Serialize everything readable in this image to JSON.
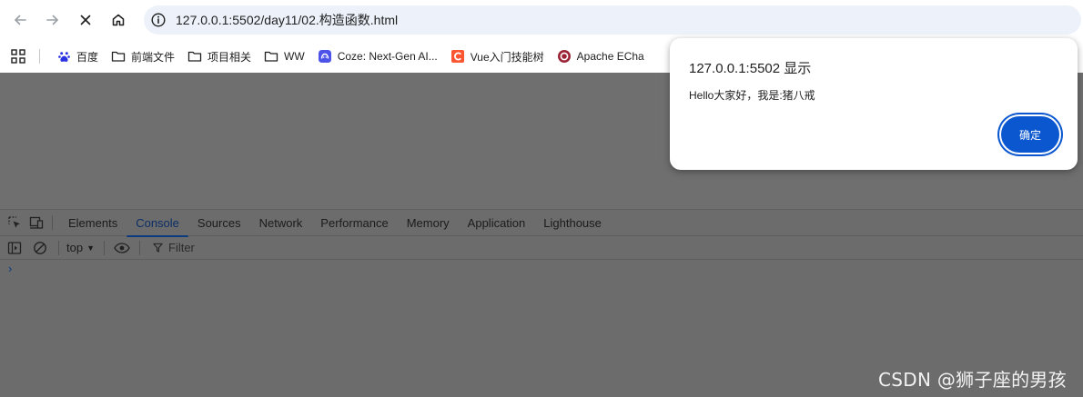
{
  "browser": {
    "url": "127.0.0.1:5502/day11/02.构造函数.html",
    "icons": [
      "back-icon",
      "forward-icon",
      "stop-icon",
      "home-icon",
      "site-info-icon"
    ]
  },
  "bookmarks": [
    {
      "label": "百度",
      "icon": "baidu-icon"
    },
    {
      "label": "前端文件",
      "icon": "folder-icon"
    },
    {
      "label": "项目相关",
      "icon": "folder-icon"
    },
    {
      "label": "WW",
      "icon": "folder-icon"
    },
    {
      "label": "Coze: Next-Gen AI...",
      "icon": "coze-icon"
    },
    {
      "label": "Vue入门技能树",
      "icon": "csdn-icon"
    },
    {
      "label": "Apache ECha",
      "icon": "echarts-icon"
    }
  ],
  "devtools": {
    "tabs": [
      "Elements",
      "Console",
      "Sources",
      "Network",
      "Performance",
      "Memory",
      "Application",
      "Lighthouse"
    ],
    "active_tab": "Console",
    "context": "top",
    "filter_placeholder": "Filter",
    "prompt": "›"
  },
  "dialog": {
    "title": "127.0.0.1:5502 显示",
    "message": "Hello大家好，我是:猪八戒",
    "ok_label": "确定"
  },
  "watermark": "CSDN @狮子座的男孩",
  "colors": {
    "accent": "#0b57d0",
    "omnibox_bg": "#edf2fa",
    "dim_overlay": "#6e6e6e"
  }
}
